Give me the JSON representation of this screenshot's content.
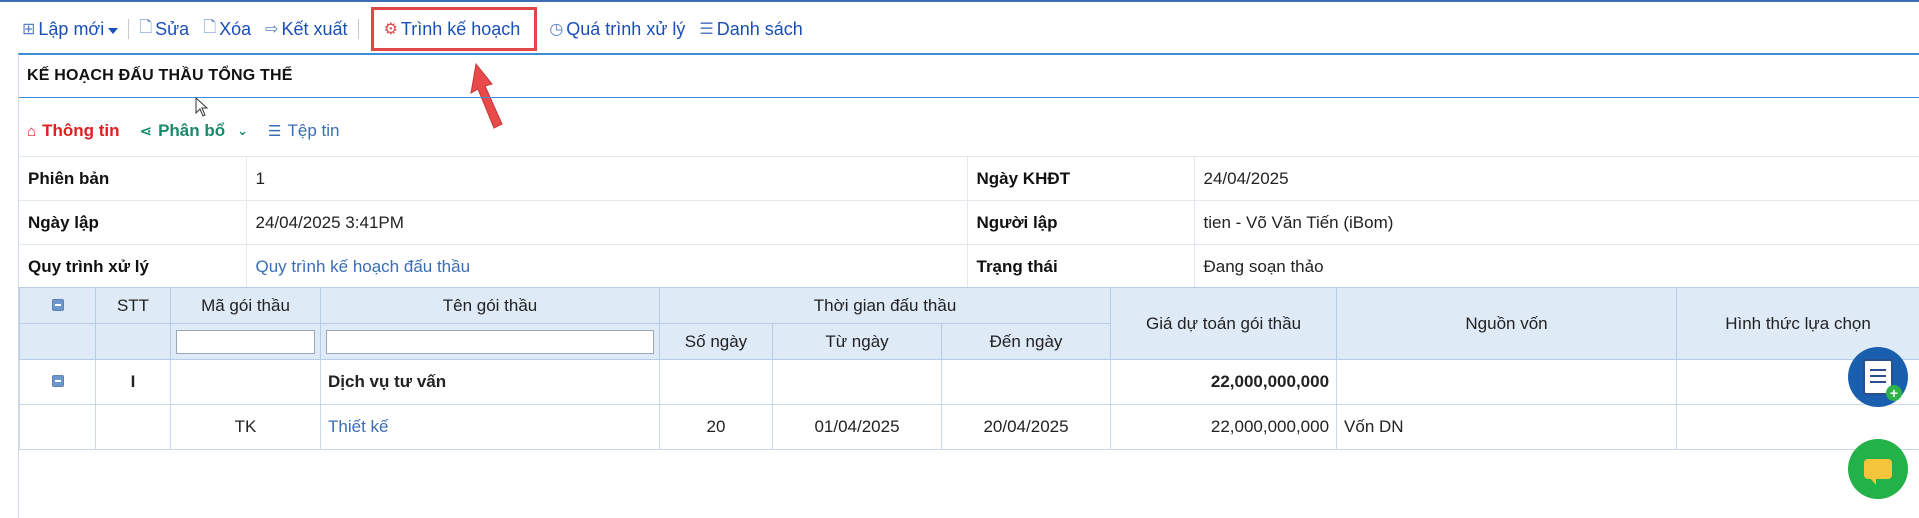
{
  "toolbar": {
    "new_label": "Lập mới",
    "edit_label": "Sửa",
    "delete_label": "Xóa",
    "export_label": "Kết xuất",
    "submit_plan_label": "Trình kế hoạch",
    "process_label": "Quá trình xử lý",
    "list_label": "Danh sách"
  },
  "panel": {
    "title": "KẾ HOẠCH ĐẤU THẦU TỔNG THỂ"
  },
  "tabs": {
    "info": "Thông tin",
    "allocation": "Phân bổ",
    "files": "Tệp tin"
  },
  "info": {
    "version_label": "Phiên bản",
    "version_value": "1",
    "plan_date_label": "Ngày KHĐT",
    "plan_date_value": "24/04/2025",
    "created_date_label": "Ngày lập",
    "created_date_value": "24/04/2025 3:41PM",
    "creator_label": "Người lập",
    "creator_value": "tien - Võ Văn Tiến (iBom)",
    "workflow_label": "Quy trình xử lý",
    "workflow_value": "Quy trình kế hoạch đấu thầu",
    "status_label": "Trạng thái",
    "status_value": "Đang soạn thảo"
  },
  "grid": {
    "headers": {
      "stt": "STT",
      "package_code": "Mã gói thầu",
      "package_name": "Tên gói thầu",
      "bid_time": "Thời gian đấu thầu",
      "days": "Số ngày",
      "from_date": "Từ ngày",
      "to_date": "Đến ngày",
      "estimate": "Giá dự toán gói thầu",
      "funding": "Nguồn vốn",
      "selection_method": "Hình thức lựa chọn"
    },
    "group": {
      "stt": "I",
      "name": "Dịch vụ tư vấn",
      "estimate": "22,000,000,000"
    },
    "rows": [
      {
        "code": "TK",
        "name": "Thiết kế",
        "days": "20",
        "from": "01/04/2025",
        "to": "20/04/2025",
        "estimate": "22,000,000,000",
        "funding": "Vốn DN",
        "method": ""
      }
    ]
  },
  "colors": {
    "link": "#1b4fb8",
    "highlight_border": "#e04848",
    "header_bg": "#dfeaf7",
    "accent_line": "#3c8fd6"
  }
}
